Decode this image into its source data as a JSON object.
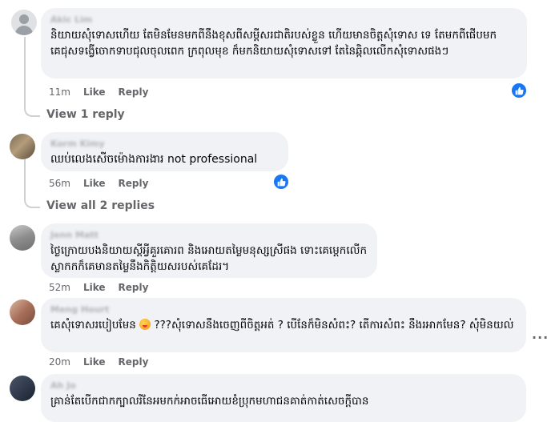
{
  "comments": [
    {
      "author": "Akic Lim",
      "text": "និយាយសុំទោសហើយ តែមិនមែនមកពីនឹងខុសពីសម្ដីសរជាតិរបស់ខ្លួន ហើយមានចិត្តសុំទោស ទេ តែមកពីផើបមកគេជុសទង្វើចោកទាបជុលចុលពេក ក្រពុលមុខ ក៏មកនិយាយសុំទោសទៅ តែនៃឆ្កិលលើកសុំទោសផងៗ",
      "time": "11m",
      "like_label": "Like",
      "reply_label": "Reply"
    },
    {
      "author": "Korm Kimy",
      "text": "ឈប់លេងសើចម៉ោងការងារ not professional",
      "time": "56m",
      "like_label": "Like",
      "reply_label": "Reply"
    },
    {
      "author": "Jenn Matt",
      "text": "ថ្ងៃក្រោយបងនិយាយស្ដីអ្វីគួរគោរព និងអោយតម្លៃមនុស្សស្រីផង ទោះគេម្ដេកលើកស្លាកកក៏គេមានតម្លៃនឹងកិត្តិយសរបស់គេដែរ។",
      "time": "52m",
      "like_label": "Like",
      "reply_label": "Reply"
    },
    {
      "author": "Meng Hourt",
      "text_before": "គេសុំទោសរបៀបមែន ",
      "text_after": " ???សុំទោសនឹងចេញពីចិត្តអត់ ? បើនែក៏មិនសំពះ? តើការសំពះ នឹងរអាកមែន? សុំមិនយល់",
      "time": "20m",
      "like_label": "Like",
      "reply_label": "Reply"
    },
    {
      "author": "Ah Jo",
      "text": "គ្រាន់តែបើកជាកក្បាលរីនែអមកក់អាចធើអោយខំប្រុកមហាជនគាត់កាត់សេចក្ដីបាន"
    }
  ],
  "replies_links": {
    "first": "View 1 reply",
    "second": "View all 2 replies"
  },
  "more_label": "···",
  "icons": {
    "reaction": "like-icon",
    "accent": "#1877f2"
  }
}
